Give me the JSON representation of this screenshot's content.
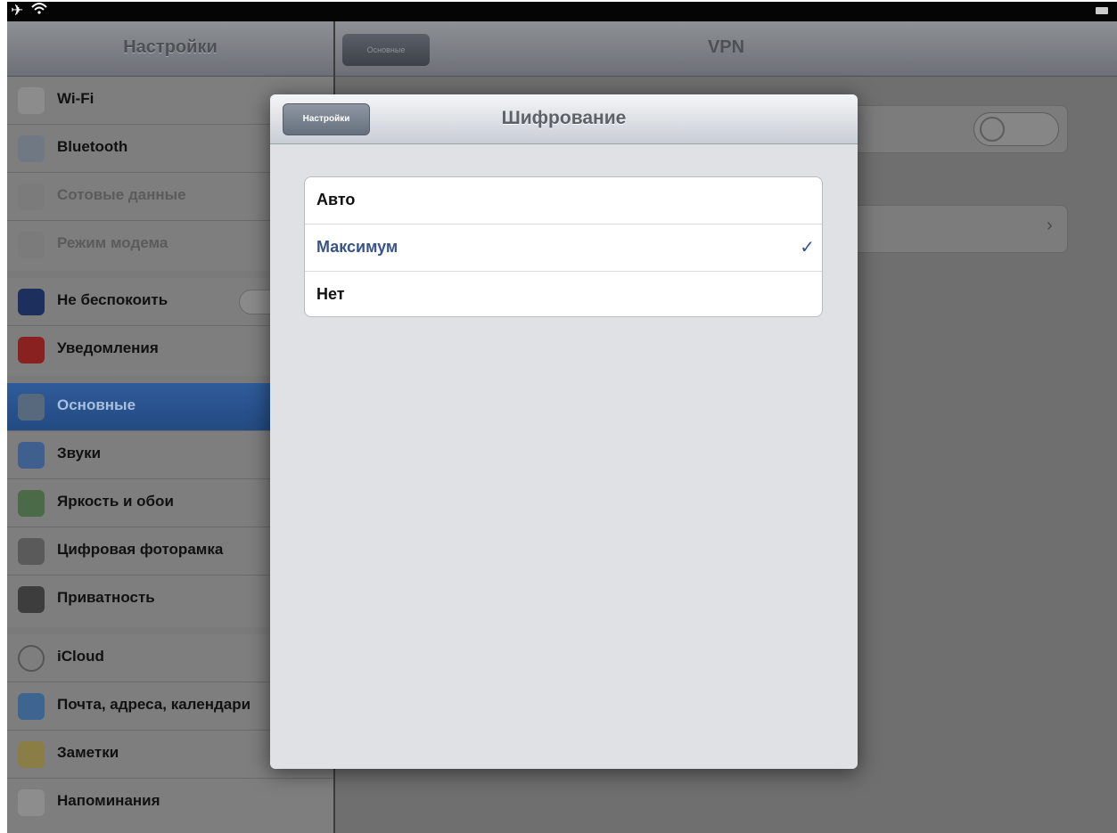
{
  "sidebar": {
    "title": "Настройки",
    "items": [
      {
        "label": "Wi-Fi",
        "icon": "wifi-icon",
        "dim": false
      },
      {
        "label": "Bluetooth",
        "icon": "bluetooth-icon",
        "dim": false
      },
      {
        "label": "Сотовые данные",
        "icon": "cellular-icon",
        "dim": true
      },
      {
        "label": "Режим модема",
        "icon": "hotspot-icon",
        "dim": true
      },
      {
        "label": "Не беспокоить",
        "icon": "moon-icon",
        "dim": false
      },
      {
        "label": "Уведомления",
        "icon": "notifications-icon",
        "dim": false
      },
      {
        "label": "Основные",
        "icon": "gear-icon",
        "selected": true
      },
      {
        "label": "Звуки",
        "icon": "speaker-icon",
        "dim": false
      },
      {
        "label": "Яркость и обои",
        "icon": "wallpaper-icon",
        "dim": false
      },
      {
        "label": "Цифровая фоторамка",
        "icon": "photo-frame-icon",
        "dim": false
      },
      {
        "label": "Приватность",
        "icon": "privacy-hand-icon",
        "dim": false
      },
      {
        "label": "iCloud",
        "icon": "cloud-icon",
        "dim": false
      },
      {
        "label": "Почта, адреса, календари",
        "icon": "mail-icon",
        "dim": false
      },
      {
        "label": "Заметки",
        "icon": "notes-icon",
        "dim": false
      },
      {
        "label": "Напоминания",
        "icon": "reminders-icon",
        "dim": false
      }
    ]
  },
  "detail": {
    "title": "VPN",
    "back_label": "Основные"
  },
  "modal": {
    "title": "Шифрование",
    "back_label": "Настройки",
    "options": [
      {
        "label": "Авто",
        "selected": false
      },
      {
        "label": "Максимум",
        "selected": true
      },
      {
        "label": "Нет",
        "selected": false
      }
    ]
  },
  "colors": {
    "selection_blue": "#234a82",
    "selected_option_text": "#385487"
  }
}
